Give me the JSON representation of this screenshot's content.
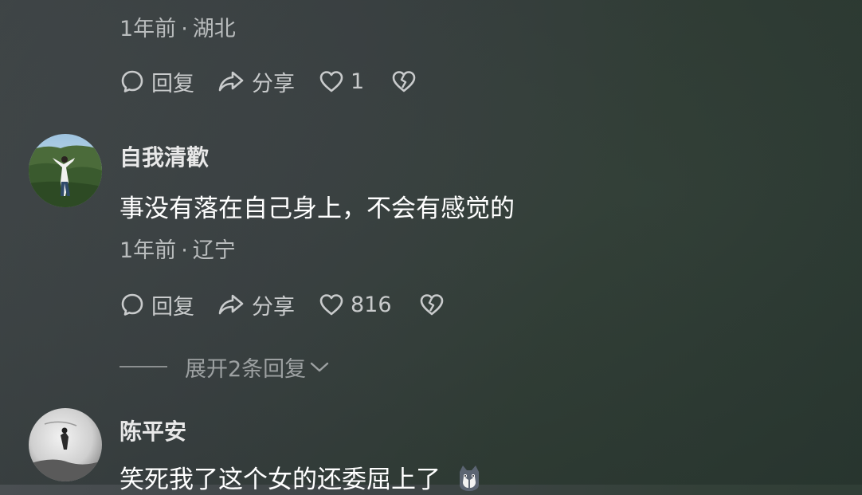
{
  "comments": [
    {
      "meta": {
        "time": "1年前",
        "location": "湖北"
      },
      "actions": {
        "reply": "回复",
        "share": "分享",
        "likes": "1"
      }
    },
    {
      "username": "自我清歡",
      "text": "事没有落在自己身上，不会有感觉的",
      "meta": {
        "time": "1年前",
        "location": "辽宁"
      },
      "actions": {
        "reply": "回复",
        "share": "分享",
        "likes": "816"
      },
      "expand_replies": "展开2条回复"
    },
    {
      "username": "陈平安",
      "text": "笑死我了这个女的还委屈上了"
    }
  ],
  "icons": {
    "reply": "comment-bubble-icon",
    "share": "share-arrow-icon",
    "like": "heart-icon",
    "dislike": "broken-heart-icon",
    "expand": "chevron-down-icon"
  },
  "colors": {
    "text_primary": "#ffffff",
    "text_secondary": "#b9bcbd",
    "action": "#c9cbcc"
  }
}
